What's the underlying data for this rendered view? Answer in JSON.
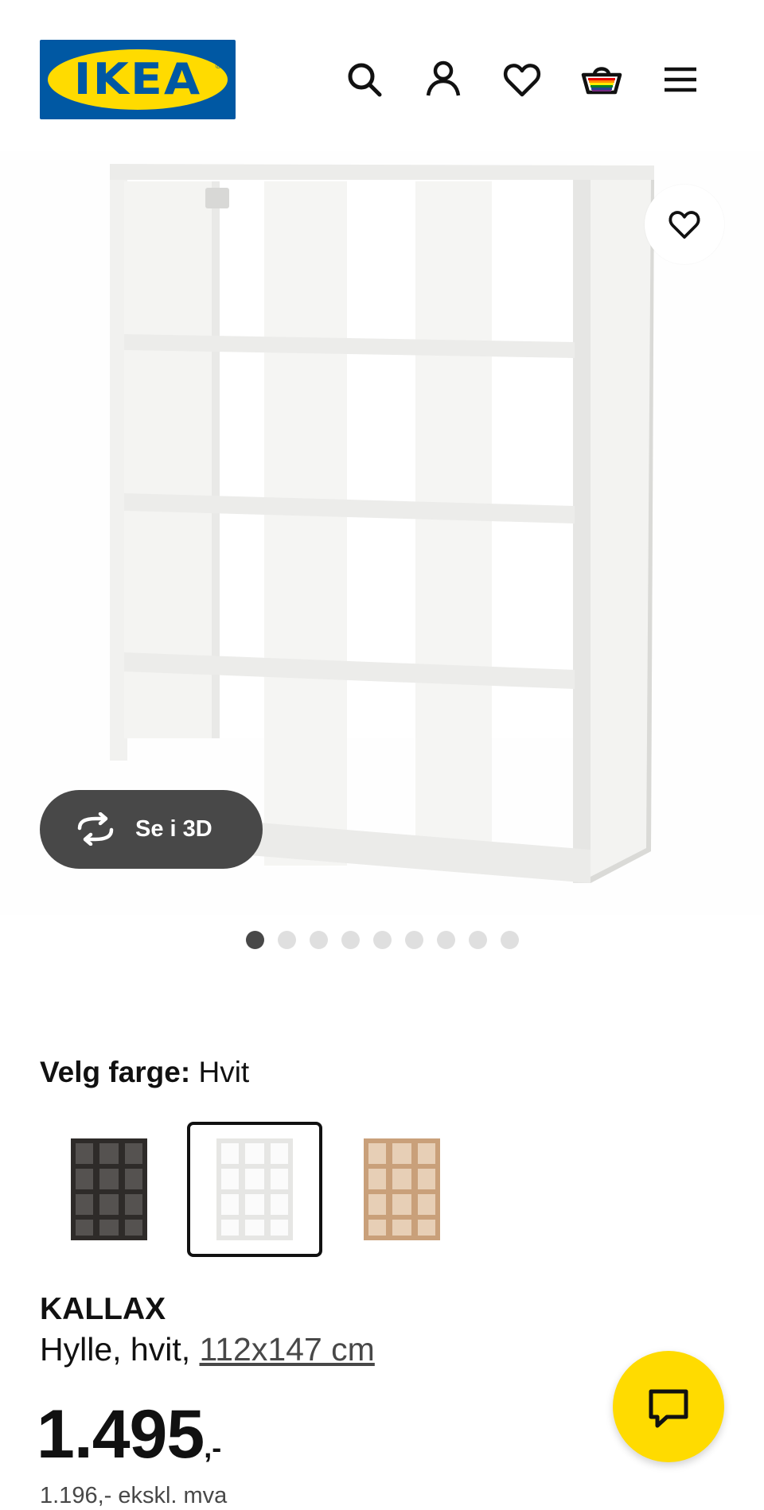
{
  "header": {
    "logo_text": "IKEA",
    "logo_registered": "®",
    "icons": [
      "search-icon",
      "user-icon",
      "heart-icon",
      "basket-icon",
      "menu-icon"
    ]
  },
  "hero": {
    "view_3d_label": "Se i 3D",
    "slide_count": 9,
    "active_slide": 1
  },
  "color_picker": {
    "label": "Velg farge:",
    "selected_value": "Hvit",
    "swatches": [
      {
        "color": "#2e2b29",
        "selected": false
      },
      {
        "color": "#ffffff",
        "selected": true
      },
      {
        "color": "#c9a07a",
        "selected": false
      }
    ]
  },
  "product": {
    "name": "KALLAX",
    "description": "Hylle, hvit, ",
    "dimensions": "112x147 cm",
    "price_main": "1.495",
    "price_suffix": ",-",
    "price_ex_vat": "1.196,- ekskl. mva"
  },
  "colors": {
    "brand_blue": "#0058a3",
    "brand_yellow": "#ffdb00",
    "dark_button": "#484848"
  }
}
